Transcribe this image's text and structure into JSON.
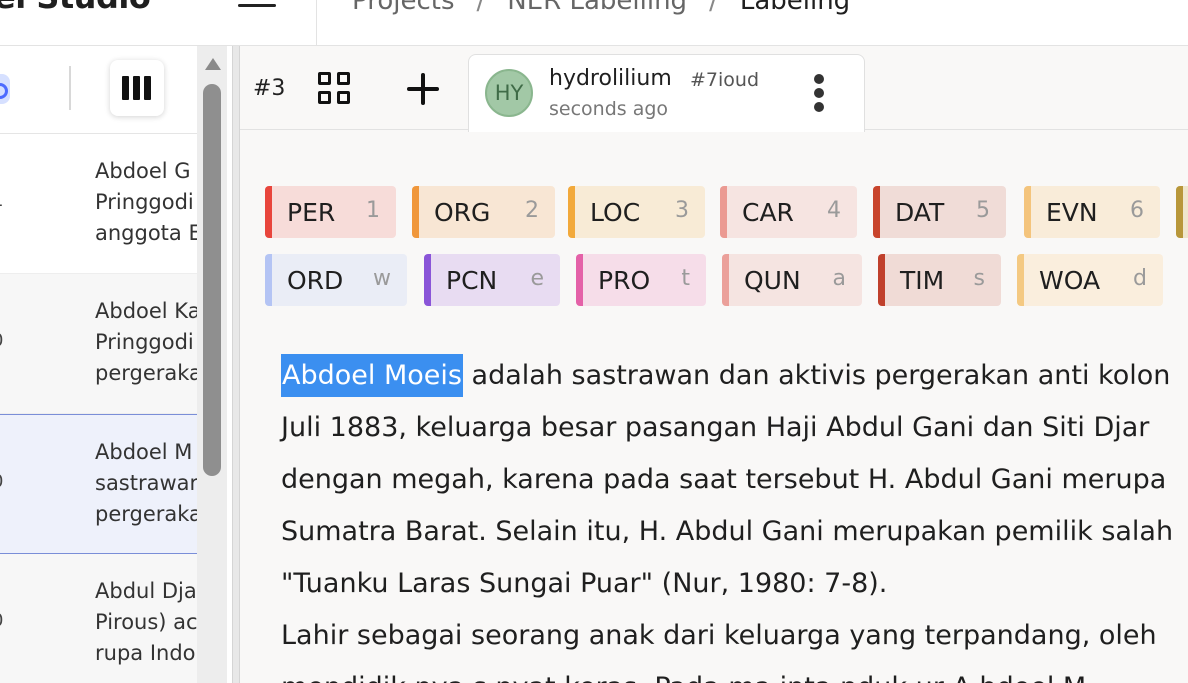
{
  "header": {
    "brand": "el Studio",
    "breadcrumb": [
      "Projects",
      "NER Labelling",
      "Labeling"
    ],
    "sep": "/"
  },
  "left_panel": {
    "tasks": [
      {
        "edge": "1",
        "lines": [
          "Abdoel G",
          "Pringgodi",
          "anggota E"
        ]
      },
      {
        "edge": "0",
        "lines": [
          "Abdoel Ka",
          "Pringgodi",
          "pergeraka"
        ]
      },
      {
        "edge": "0",
        "lines": [
          "Abdoel M",
          "sastrawar",
          "pergeraka"
        ]
      },
      {
        "edge": "0",
        "lines": [
          "Abdul Dja",
          "Pirous) ac",
          "rupa Indo"
        ]
      }
    ],
    "selected_index": 2
  },
  "tab_bar": {
    "task_number": "#3",
    "annotation": {
      "avatar_initials": "HY",
      "user": "hydrolilium",
      "id": "#7ioud",
      "time": "seconds ago"
    }
  },
  "labels": [
    {
      "name": "PER",
      "hotkey": "1",
      "color": "#e8453c",
      "bg": "#f7dcd9"
    },
    {
      "name": "ORG",
      "hotkey": "2",
      "color": "#f0973b",
      "bg": "#f8e6d4"
    },
    {
      "name": "LOC",
      "hotkey": "3",
      "color": "#f2a93b",
      "bg": "#f8ebd6"
    },
    {
      "name": "CAR",
      "hotkey": "4",
      "color": "#eb9a92",
      "bg": "#f6e4e1"
    },
    {
      "name": "DAT",
      "hotkey": "5",
      "color": "#c8442c",
      "bg": "#f0dcd7"
    },
    {
      "name": "EVN",
      "hotkey": "6",
      "color": "#f4c47c",
      "bg": "#f9ecd9"
    },
    {
      "name": "ORD",
      "hotkey": "w",
      "color": "#b4c4f4",
      "bg": "#eaedf6"
    },
    {
      "name": "PCN",
      "hotkey": "e",
      "color": "#8a55d8",
      "bg": "#e8dcf2"
    },
    {
      "name": "PRO",
      "hotkey": "t",
      "color": "#e461a8",
      "bg": "#f6dde9"
    },
    {
      "name": "QUN",
      "hotkey": "a",
      "color": "#eba09a",
      "bg": "#f5e4e1"
    },
    {
      "name": "TIM",
      "hotkey": "s",
      "color": "#c0402c",
      "bg": "#f0dbd6"
    },
    {
      "name": "WOA",
      "hotkey": "d",
      "color": "#f4c982",
      "bg": "#faeedd"
    }
  ],
  "document": {
    "highlight": "Abdoel Moeis",
    "first_line_rest": " adalah sastrawan dan aktivis pergerakan anti kolon",
    "lines": [
      "Juli 1883, keluarga besar pasangan Haji Abdul Gani dan Siti Djar",
      "dengan megah, karena pada saat tersebut H. Abdul Gani merupa",
      "Sumatra Barat. Selain itu, H. Abdul Gani merupakan pemilik salah",
      "\"Tuanku Laras Sungai Puar\" (Nur, 1980: 7-8).",
      "Lahir sebagai seorang anak dari keluarga yang terpandang, oleh",
      "mendidik  nya s  nyat keras. Pada ma  inta  nduk  ur A  bdoel M"
    ]
  }
}
